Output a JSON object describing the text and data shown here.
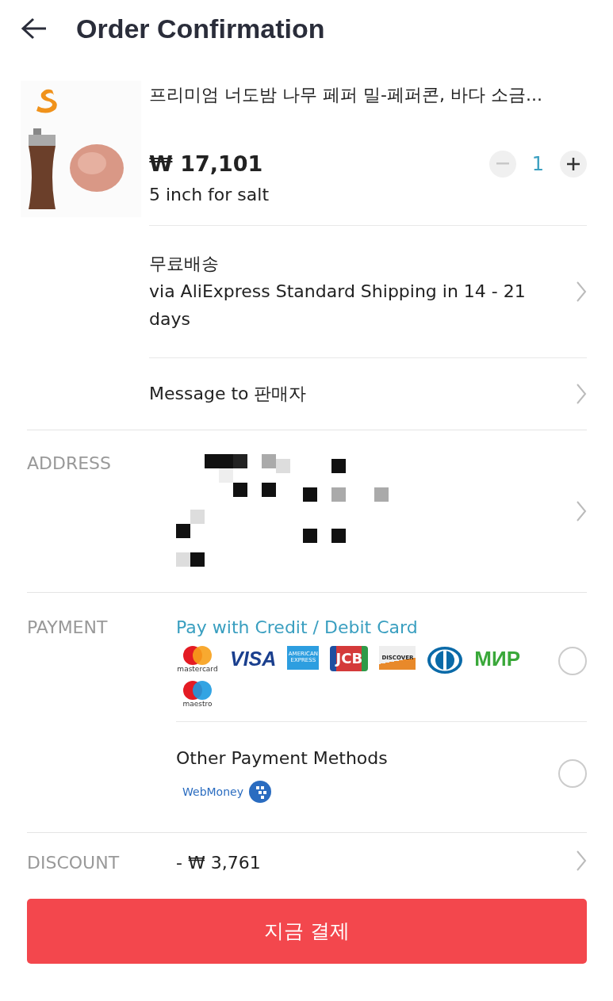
{
  "header": {
    "title": "Order Confirmation"
  },
  "product": {
    "title": "프리미엄 너도밤 나무 페퍼 밀-페퍼콘, 바다 소금...",
    "price": "₩ 17,101",
    "variant": "5 inch for salt",
    "quantity": "1"
  },
  "shipping": {
    "title": "무료배송",
    "detail": "via AliExpress Standard Shipping in 14 - 21 days"
  },
  "message": {
    "label": "Message to 판매자"
  },
  "address": {
    "label": "ADDRESS"
  },
  "payment": {
    "label": "PAYMENT",
    "options": [
      {
        "kind": "cards",
        "title": "Pay with Credit / Debit Card",
        "selected": false,
        "logos": [
          {
            "kind": "mastercard",
            "label": "mastercard"
          },
          {
            "kind": "visa",
            "label": "VISA"
          },
          {
            "kind": "amex",
            "label": "AMERICAN EXPRESS"
          },
          {
            "kind": "jcb",
            "label": "JCB"
          },
          {
            "kind": "discover",
            "label": "DISCOVER"
          },
          {
            "kind": "diners"
          },
          {
            "kind": "mir",
            "label": "МИР"
          },
          {
            "kind": "maestro",
            "label": "maestro"
          }
        ]
      },
      {
        "kind": "other",
        "title": "Other Payment Methods",
        "selected": false,
        "logos": [
          {
            "kind": "webmoney",
            "label": "WebMoney"
          }
        ]
      }
    ]
  },
  "discount": {
    "label": "DISCOUNT",
    "value": "- ₩ 3,761"
  },
  "pay_button": {
    "label": "지금 결제"
  }
}
